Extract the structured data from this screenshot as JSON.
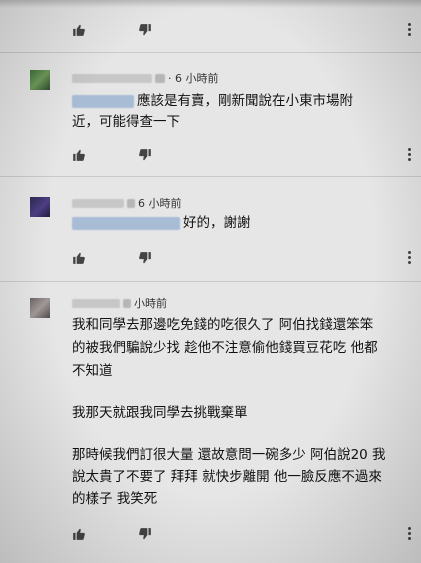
{
  "comments": [
    {
      "time": "· 6 小時前",
      "text_lines": [
        "應該是有賣，剛新聞說在小東市場附",
        "近，可能得查一下"
      ]
    },
    {
      "time": "6 小時前",
      "text_lines": [
        "好的，謝謝"
      ]
    },
    {
      "time": "小時前",
      "text_lines": [
        "我和同學去那邊吃免錢的吃很久了 阿伯找錢還笨笨",
        "的被我們騙說少找 趁他不注意偷他錢買豆花吃 他都",
        "不知道",
        "",
        "我那天就跟我同學去挑戰棄單",
        "",
        "那時候我們訂很大量 還故意問一碗多少 阿伯說20 我",
        "說太貴了不要了 拜拜 就快步離開 他一臉反應不過來",
        "的樣子 我笑死"
      ]
    }
  ],
  "icons": {
    "like": "thumbs-up-icon",
    "dislike": "thumbs-down-icon",
    "more": "more-vert-icon"
  }
}
